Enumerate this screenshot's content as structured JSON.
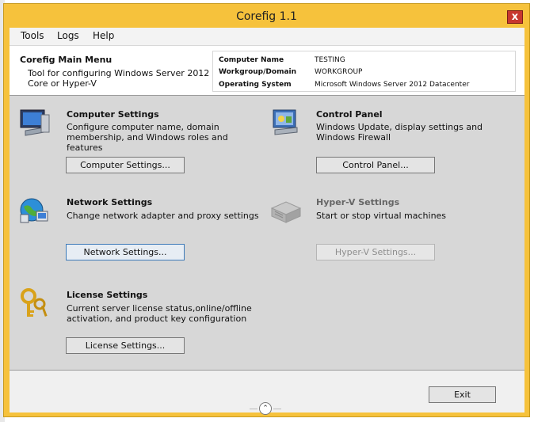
{
  "window": {
    "title": "Corefig 1.1",
    "close_label": "x"
  },
  "menu": [
    {
      "label": "Tools"
    },
    {
      "label": "Logs"
    },
    {
      "label": "Help"
    }
  ],
  "header": {
    "title": "Corefig Main Menu",
    "description": "Tool for configuring Windows Server 2012 Core or Hyper-V",
    "info": [
      {
        "label": "Computer Name",
        "value": "TESTING"
      },
      {
        "label": "Workgroup/Domain",
        "value": "WORKGROUP"
      },
      {
        "label": "Operating System",
        "value": "Microsoft Windows Server 2012 Datacenter"
      }
    ]
  },
  "sections": {
    "computer": {
      "title": "Computer Settings",
      "description": "Configure computer name, domain membership, and Windows roles and features",
      "button": "Computer Settings...",
      "icon": "computer-icon"
    },
    "control": {
      "title": "Control Panel",
      "description": "Windows Update, display settings and Windows Firewall",
      "button": "Control Panel...",
      "icon": "control-panel-icon"
    },
    "network": {
      "title": "Network Settings",
      "description": "Change network adapter and proxy settings",
      "button": "Network Settings...",
      "icon": "network-globe-icon"
    },
    "hyperv": {
      "title": "Hyper-V Settings",
      "description": "Start or stop virtual machines",
      "button": "Hyper-V Settings...",
      "icon": "server-icon"
    },
    "license": {
      "title": "License Settings",
      "description": "Current server license status,online/offline activation, and product key configuration",
      "button": "License Settings...",
      "icon": "keys-icon"
    }
  },
  "footer": {
    "exit_label": "Exit",
    "collapse_glyph": "⌃"
  }
}
